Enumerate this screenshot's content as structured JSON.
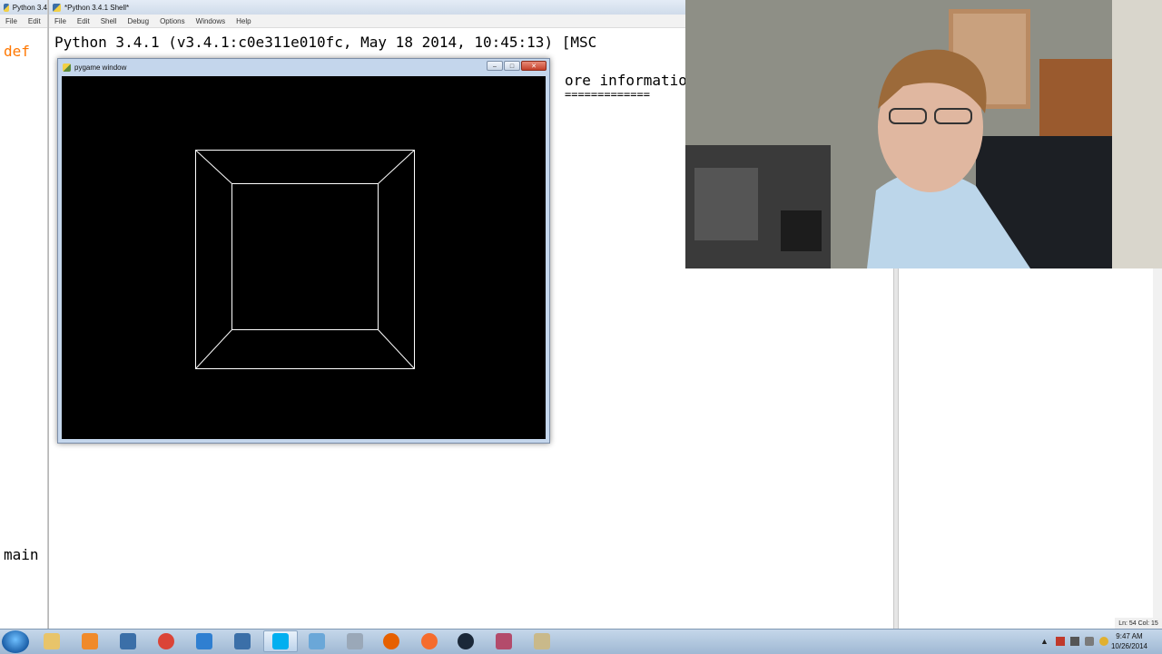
{
  "left_window": {
    "title": "Python 3.4",
    "menu": [
      "File",
      "Edit"
    ],
    "code_def": "def",
    "code_main": "main"
  },
  "shell": {
    "title": "*Python 3.4.1 Shell*",
    "menu": [
      "File",
      "Edit",
      "Shell",
      "Debug",
      "Options",
      "Windows",
      "Help"
    ],
    "lines": [
      "Python 3.4.1 (v3.4.1:c0e311e010fc, May 18 2014, 10:45:13) [MSC",
      "ore informatio",
      "============="
    ]
  },
  "pygame_window": {
    "title": "pygame window",
    "minimize": "–",
    "maximize": "□",
    "close": "✕"
  },
  "editor_status": "Ln: 54  Col: 15",
  "taskbar": {
    "apps": [
      {
        "name": "windows-explorer",
        "color": "#e8c46a",
        "active": false
      },
      {
        "name": "media-player",
        "color": "#f08a2a",
        "active": false
      },
      {
        "name": "python-file",
        "color": "#3b6fa8",
        "active": false
      },
      {
        "name": "chrome",
        "color": "#db4437",
        "active": false
      },
      {
        "name": "app-blue",
        "color": "#2f7fd1",
        "active": false
      },
      {
        "name": "python-idle",
        "color": "#3b6fa8",
        "active": false
      },
      {
        "name": "skype",
        "color": "#00aff0",
        "active": true
      },
      {
        "name": "notepad",
        "color": "#6aa7d8",
        "active": false
      },
      {
        "name": "webcam-app",
        "color": "#9aa8b8",
        "active": false
      },
      {
        "name": "firefox",
        "color": "#e66000",
        "active": false
      },
      {
        "name": "origin",
        "color": "#f56c2d",
        "active": false
      },
      {
        "name": "steam",
        "color": "#1b2838",
        "active": false
      },
      {
        "name": "paint",
        "color": "#b34b6b",
        "active": false
      },
      {
        "name": "tool",
        "color": "#c9b98a",
        "active": false
      }
    ],
    "clock_time": "9:47 AM",
    "clock_date": "10/26/2014"
  },
  "colors": {
    "keyword": "#ff7700",
    "taskbar": "#b3c9e0",
    "wireframe": "#ffffff"
  }
}
